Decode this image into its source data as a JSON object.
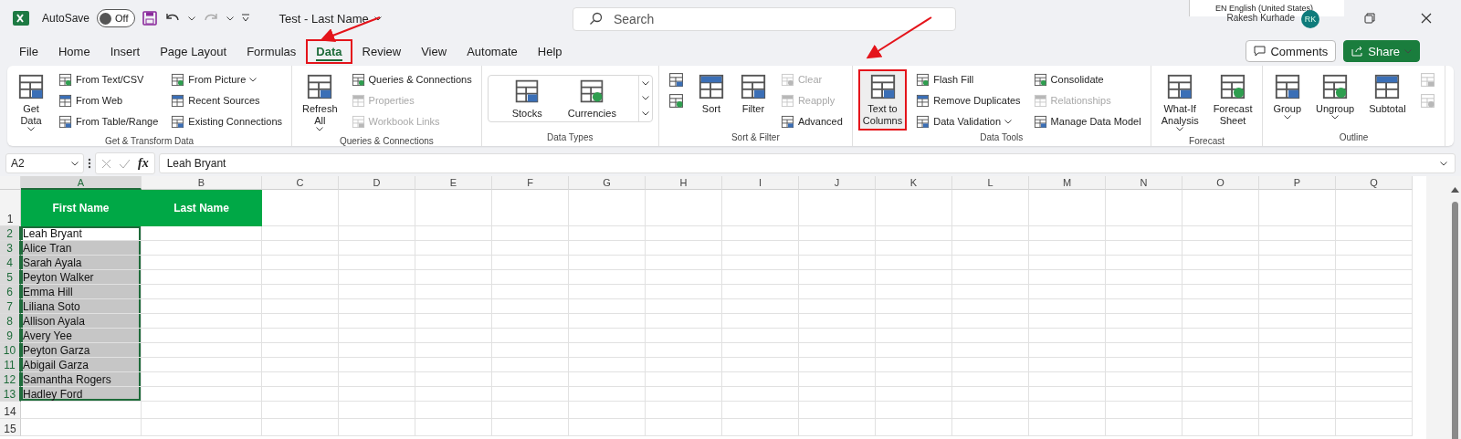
{
  "title_bar": {
    "autosave_label": "AutoSave",
    "autosave": {
      "on": false,
      "label": "Off"
    },
    "document_title": "Test - Last Name",
    "search": {
      "placeholder": "Search"
    },
    "language_popup": "EN English (United States)",
    "user_name": "Rakesh Kurhade",
    "avatar": "RK"
  },
  "tabs": [
    {
      "label": "File",
      "selected": false,
      "highlighted": false
    },
    {
      "label": "Home",
      "selected": false,
      "highlighted": false
    },
    {
      "label": "Insert",
      "selected": false,
      "highlighted": false
    },
    {
      "label": "Page Layout",
      "selected": false,
      "highlighted": false
    },
    {
      "label": "Formulas",
      "selected": false,
      "highlighted": false
    },
    {
      "label": "Data",
      "selected": true,
      "highlighted": true
    },
    {
      "label": "Review",
      "selected": false,
      "highlighted": false
    },
    {
      "label": "View",
      "selected": false,
      "highlighted": false
    },
    {
      "label": "Automate",
      "selected": false,
      "highlighted": false
    },
    {
      "label": "Help",
      "selected": false,
      "highlighted": false
    }
  ],
  "actions": [
    {
      "label": "Comments",
      "kind": "outline"
    },
    {
      "label": "Share",
      "kind": "primary"
    }
  ],
  "ribbon": {
    "groups": [
      {
        "label": "Get & Transform Data",
        "items": [
          {
            "label": [
              "Get",
              "Data"
            ],
            "kind": "large",
            "dropdown": true,
            "disabled": false,
            "highlighted": false
          },
          {
            "label": [
              "From Text/CSV"
            ],
            "kind": "small",
            "dropdown": false,
            "disabled": false,
            "highlighted": false
          },
          {
            "label": [
              "From Web"
            ],
            "kind": "small",
            "dropdown": false,
            "disabled": false,
            "highlighted": false
          },
          {
            "label": [
              "From Table/Range"
            ],
            "kind": "small",
            "dropdown": false,
            "disabled": false,
            "highlighted": false
          },
          {
            "label": [
              "From Picture"
            ],
            "kind": "small",
            "dropdown": true,
            "disabled": false,
            "highlighted": false
          },
          {
            "label": [
              "Recent Sources"
            ],
            "kind": "small",
            "dropdown": false,
            "disabled": false,
            "highlighted": false
          },
          {
            "label": [
              "Existing Connections"
            ],
            "kind": "small",
            "dropdown": false,
            "disabled": false,
            "highlighted": false
          }
        ]
      },
      {
        "label": "Queries & Connections",
        "items": [
          {
            "label": [
              "Refresh",
              "All"
            ],
            "kind": "large",
            "dropdown": true,
            "disabled": false,
            "highlighted": false
          },
          {
            "label": [
              "Queries & Connections"
            ],
            "kind": "small",
            "dropdown": false,
            "disabled": false,
            "highlighted": false
          },
          {
            "label": [
              "Properties"
            ],
            "kind": "small",
            "dropdown": false,
            "disabled": true,
            "highlighted": false
          },
          {
            "label": [
              "Workbook Links"
            ],
            "kind": "small",
            "dropdown": false,
            "disabled": true,
            "highlighted": false
          }
        ]
      },
      {
        "label": "Data Types",
        "items": [
          {
            "label": [
              "Stocks"
            ],
            "kind": "gallery",
            "dropdown": false,
            "disabled": false,
            "highlighted": false
          },
          {
            "label": [
              "Currencies"
            ],
            "kind": "gallery",
            "dropdown": false,
            "disabled": false,
            "highlighted": false
          }
        ]
      },
      {
        "label": "Sort & Filter",
        "items": [
          {
            "kind": "icon",
            "dropdown": false,
            "disabled": false,
            "highlighted": false
          },
          {
            "kind": "icon",
            "dropdown": false,
            "disabled": false,
            "highlighted": false
          },
          {
            "label": [
              "Sort"
            ],
            "kind": "large",
            "dropdown": false,
            "disabled": false,
            "highlighted": false
          },
          {
            "label": [
              "Filter"
            ],
            "kind": "large",
            "dropdown": false,
            "disabled": false,
            "highlighted": false
          },
          {
            "label": [
              "Clear"
            ],
            "kind": "small",
            "dropdown": false,
            "disabled": true,
            "highlighted": false
          },
          {
            "label": [
              "Reapply"
            ],
            "kind": "small",
            "dropdown": false,
            "disabled": true,
            "highlighted": false
          },
          {
            "label": [
              "Advanced"
            ],
            "kind": "small",
            "dropdown": false,
            "disabled": false,
            "highlighted": false
          }
        ]
      },
      {
        "label": "Data Tools",
        "items": [
          {
            "label": [
              "Text to",
              "Columns"
            ],
            "kind": "large",
            "dropdown": false,
            "disabled": false,
            "highlighted": true
          },
          {
            "label": [
              "Flash Fill"
            ],
            "kind": "small",
            "dropdown": false,
            "disabled": false,
            "highlighted": false
          },
          {
            "label": [
              "Remove Duplicates"
            ],
            "kind": "small",
            "dropdown": false,
            "disabled": false,
            "highlighted": false
          },
          {
            "label": [
              "Data Validation"
            ],
            "kind": "small",
            "dropdown": true,
            "disabled": false,
            "highlighted": false
          },
          {
            "label": [
              "Consolidate"
            ],
            "kind": "small",
            "dropdown": false,
            "disabled": false,
            "highlighted": false
          },
          {
            "label": [
              "Relationships"
            ],
            "kind": "small",
            "dropdown": false,
            "disabled": true,
            "highlighted": false
          },
          {
            "label": [
              "Manage Data Model"
            ],
            "kind": "small",
            "dropdown": false,
            "disabled": false,
            "highlighted": false
          }
        ]
      },
      {
        "label": "Forecast",
        "items": [
          {
            "label": [
              "What-If",
              "Analysis"
            ],
            "kind": "large",
            "dropdown": true,
            "disabled": false,
            "highlighted": false
          },
          {
            "label": [
              "Forecast",
              "Sheet"
            ],
            "kind": "large",
            "dropdown": false,
            "disabled": false,
            "highlighted": false
          }
        ]
      },
      {
        "label": "Outline",
        "items": [
          {
            "label": [
              "Group"
            ],
            "kind": "large",
            "dropdown": true,
            "disabled": false,
            "highlighted": false
          },
          {
            "label": [
              "Ungroup"
            ],
            "kind": "large",
            "dropdown": true,
            "disabled": false,
            "highlighted": false
          },
          {
            "label": [
              "Subtotal"
            ],
            "kind": "large",
            "dropdown": false,
            "disabled": false,
            "highlighted": false
          },
          {
            "kind": "icon",
            "dropdown": false,
            "disabled": true,
            "highlighted": false
          },
          {
            "kind": "icon",
            "dropdown": false,
            "disabled": true,
            "highlighted": false
          }
        ]
      }
    ]
  },
  "formula_bar": {
    "name_box": "A2",
    "function_label": "fx",
    "value": "Leah Bryant"
  },
  "sheet": {
    "columns": [
      {
        "label": "A",
        "selected": true
      },
      {
        "label": "B",
        "selected": false
      },
      {
        "label": "C",
        "selected": false
      },
      {
        "label": "D",
        "selected": false
      },
      {
        "label": "E",
        "selected": false
      },
      {
        "label": "F",
        "selected": false
      },
      {
        "label": "G",
        "selected": false
      },
      {
        "label": "H",
        "selected": false
      },
      {
        "label": "I",
        "selected": false
      },
      {
        "label": "J",
        "selected": false
      },
      {
        "label": "K",
        "selected": false
      },
      {
        "label": "L",
        "selected": false
      },
      {
        "label": "M",
        "selected": false
      },
      {
        "label": "N",
        "selected": false
      },
      {
        "label": "O",
        "selected": false
      },
      {
        "label": "P",
        "selected": false
      },
      {
        "label": "Q",
        "selected": false
      }
    ],
    "rows": [
      {
        "number": "1",
        "kind": "header",
        "selected": false,
        "cells": [
          "First Name",
          "Last Name"
        ]
      },
      {
        "number": "2",
        "kind": "data",
        "selected": true,
        "cells": [
          "Leah Bryant"
        ]
      },
      {
        "number": "3",
        "kind": "data",
        "selected": true,
        "cells": [
          "Alice Tran"
        ]
      },
      {
        "number": "4",
        "kind": "data",
        "selected": true,
        "cells": [
          "Sarah Ayala"
        ]
      },
      {
        "number": "5",
        "kind": "data",
        "selected": true,
        "cells": [
          "Peyton Walker"
        ]
      },
      {
        "number": "6",
        "kind": "data",
        "selected": true,
        "cells": [
          "Emma Hill"
        ]
      },
      {
        "number": "7",
        "kind": "data",
        "selected": true,
        "cells": [
          "Liliana Soto"
        ]
      },
      {
        "number": "8",
        "kind": "data",
        "selected": true,
        "cells": [
          "Allison Ayala"
        ]
      },
      {
        "number": "9",
        "kind": "data",
        "selected": true,
        "cells": [
          "Avery Yee"
        ]
      },
      {
        "number": "10",
        "kind": "data",
        "selected": true,
        "cells": [
          "Peyton Garza"
        ]
      },
      {
        "number": "11",
        "kind": "data",
        "selected": true,
        "cells": [
          "Abigail Garza"
        ]
      },
      {
        "number": "12",
        "kind": "data",
        "selected": true,
        "cells": [
          "Samantha Rogers"
        ]
      },
      {
        "number": "13",
        "kind": "data",
        "selected": true,
        "cells": [
          "Hadley Ford"
        ]
      },
      {
        "number": "14",
        "kind": "data",
        "selected": false,
        "cells": []
      },
      {
        "number": "15",
        "kind": "data",
        "selected": false,
        "cells": []
      }
    ]
  }
}
